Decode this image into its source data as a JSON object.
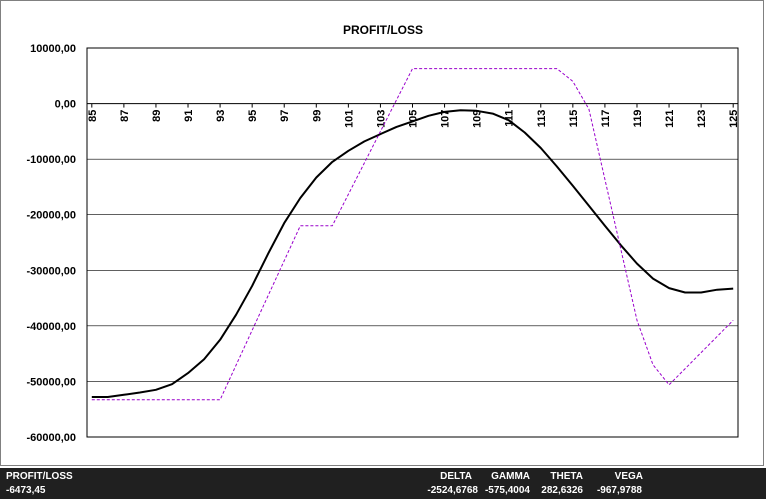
{
  "chart_data": {
    "type": "line",
    "title": "PROFIT/LOSS",
    "xlabel": "",
    "ylabel": "",
    "xlim": [
      85,
      125
    ],
    "ylim": [
      -60000,
      10000
    ],
    "x_ticks": [
      "85",
      "87",
      "89",
      "91",
      "93",
      "95",
      "97",
      "99",
      "101",
      "103",
      "105",
      "107",
      "109",
      "111",
      "113",
      "115",
      "117",
      "119",
      "121",
      "123",
      "125"
    ],
    "y_ticks": [
      "10000,00",
      "0,00",
      "-10000,00",
      "-20000,00",
      "-30000,00",
      "-40000,00",
      "-50000,00",
      "-60000,00"
    ],
    "grid": "horizontal",
    "legend": "none",
    "series": [
      {
        "style": "solid",
        "color": "#000000",
        "x": [
          85,
          86,
          87,
          88,
          89,
          90,
          91,
          92,
          93,
          94,
          95,
          96,
          97,
          98,
          99,
          100,
          101,
          102,
          103,
          104,
          105,
          106,
          107,
          108,
          109,
          110,
          111,
          112,
          113,
          114,
          115,
          116,
          117,
          118,
          119,
          120,
          121,
          122,
          123,
          124,
          125
        ],
        "y": [
          -52800,
          -52800,
          -52400,
          -52000,
          -51500,
          -50500,
          -48500,
          -46000,
          -42500,
          -38000,
          -32800,
          -27000,
          -21500,
          -17000,
          -13300,
          -10500,
          -8500,
          -6800,
          -5500,
          -4200,
          -3200,
          -2200,
          -1500,
          -1200,
          -1300,
          -1800,
          -3000,
          -5200,
          -8000,
          -11300,
          -14800,
          -18400,
          -22000,
          -25500,
          -28800,
          -31500,
          -33200,
          -34000,
          -34000,
          -33500,
          -33300
        ]
      },
      {
        "style": "dashed",
        "color": "#9900cc",
        "x": [
          85,
          93,
          98,
          100,
          105,
          114,
          115,
          116,
          119,
          120,
          121,
          125
        ],
        "y": [
          -53300,
          -53300,
          -22000,
          -22000,
          6300,
          6300,
          4000,
          -1000,
          -39000,
          -47000,
          -50600,
          -39000
        ]
      }
    ]
  },
  "status": {
    "left_label": "PROFIT/LOSS",
    "left_value": "-6473,45",
    "greeks": [
      {
        "label": "DELTA",
        "value": "-2524,6768"
      },
      {
        "label": "GAMMA",
        "value": "-575,4004"
      },
      {
        "label": "THETA",
        "value": "282,6326"
      },
      {
        "label": "VEGA",
        "value": "-967,9788"
      }
    ]
  }
}
